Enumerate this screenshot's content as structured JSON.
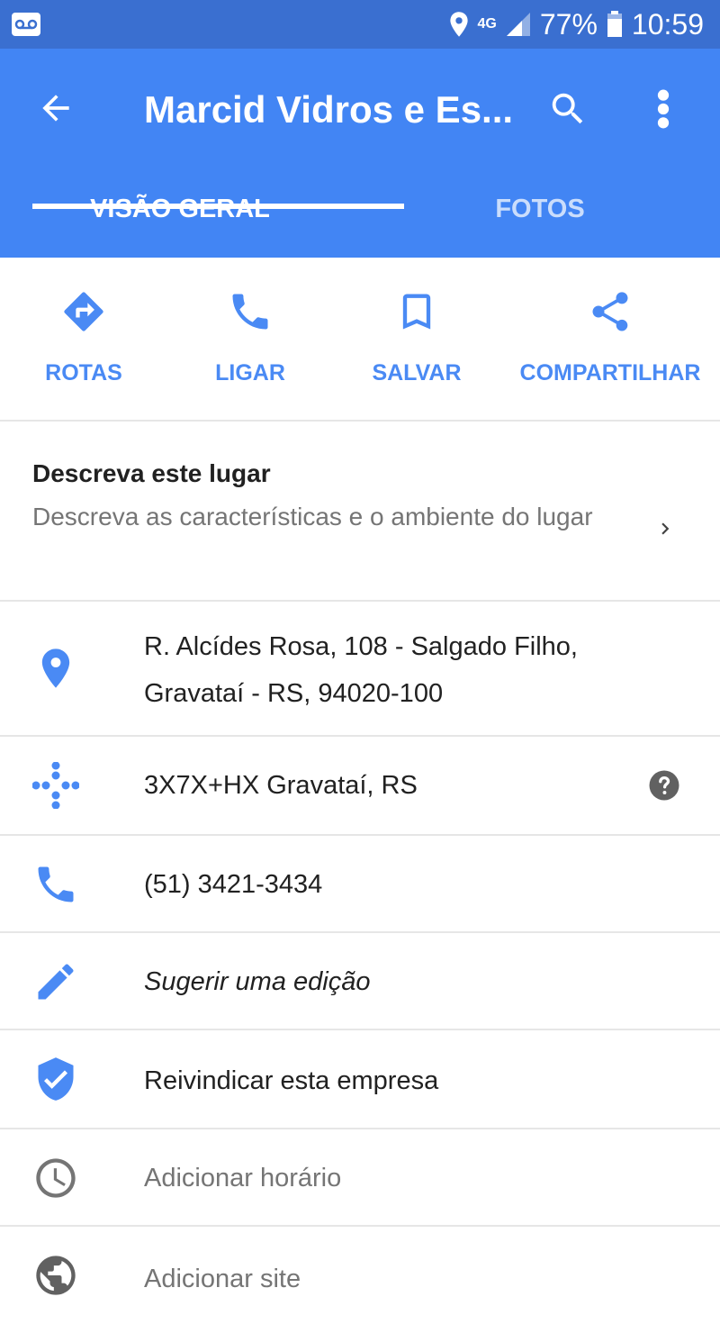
{
  "status_bar": {
    "network": "4G",
    "battery": "77%",
    "time": "10:59"
  },
  "app_bar": {
    "title": "Marcid Vidros e Es...",
    "tabs": [
      {
        "label": "VISÃO GERAL",
        "active": true
      },
      {
        "label": "FOTOS",
        "active": false
      }
    ]
  },
  "actions": [
    {
      "label": "ROTAS",
      "icon": "directions-icon"
    },
    {
      "label": "LIGAR",
      "icon": "phone-icon"
    },
    {
      "label": "SALVAR",
      "icon": "bookmark-icon"
    },
    {
      "label": "COMPARTILHAR",
      "icon": "share-icon"
    }
  ],
  "describe": {
    "heading": "Descreva este lugar",
    "subtitle": "Descreva as características e o ambiente do lugar"
  },
  "details": {
    "address_line1": "R. Alcídes Rosa, 108 - Salgado Filho,",
    "address_line2": "Gravataí - RS, 94020-100",
    "plus_code": "3X7X+HX Gravataí, RS",
    "phone": "(51) 3421-3434",
    "suggest_edit": "Sugerir uma edição",
    "claim_business": "Reivindicar esta empresa",
    "add_hours": "Adicionar horário",
    "add_site": "Adicionar site"
  },
  "colors": {
    "status_bar": "#3a6fd0",
    "app_bar": "#4285f4",
    "accent": "#4a8af4",
    "muted_icon": "#757575"
  }
}
